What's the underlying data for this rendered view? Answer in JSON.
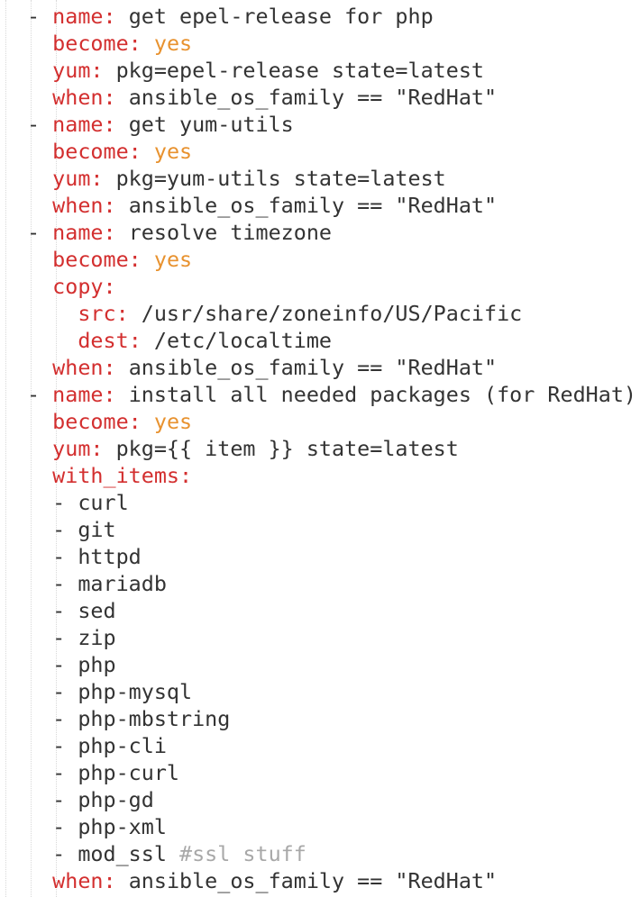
{
  "lines": [
    [
      [
        "dash",
        "- "
      ],
      [
        "key",
        "name"
      ],
      [
        "colon",
        ":"
      ],
      [
        "text",
        " get epel-release for php"
      ]
    ],
    [
      [
        "text",
        "  "
      ],
      [
        "key",
        "become"
      ],
      [
        "colon",
        ":"
      ],
      [
        "text",
        " "
      ],
      [
        "bool",
        "yes"
      ]
    ],
    [
      [
        "text",
        "  "
      ],
      [
        "key",
        "yum"
      ],
      [
        "colon",
        ":"
      ],
      [
        "text",
        " pkg=epel-release state=latest"
      ]
    ],
    [
      [
        "text",
        "  "
      ],
      [
        "key",
        "when"
      ],
      [
        "colon",
        ":"
      ],
      [
        "text",
        " ansible_os_family == \"RedHat\""
      ]
    ],
    [
      [
        "dash",
        "- "
      ],
      [
        "key",
        "name"
      ],
      [
        "colon",
        ":"
      ],
      [
        "text",
        " get yum-utils"
      ]
    ],
    [
      [
        "text",
        "  "
      ],
      [
        "key",
        "become"
      ],
      [
        "colon",
        ":"
      ],
      [
        "text",
        " "
      ],
      [
        "bool",
        "yes"
      ]
    ],
    [
      [
        "text",
        "  "
      ],
      [
        "key",
        "yum"
      ],
      [
        "colon",
        ":"
      ],
      [
        "text",
        " pkg=yum-utils state=latest"
      ]
    ],
    [
      [
        "text",
        "  "
      ],
      [
        "key",
        "when"
      ],
      [
        "colon",
        ":"
      ],
      [
        "text",
        " ansible_os_family == \"RedHat\""
      ]
    ],
    [
      [
        "dash",
        "- "
      ],
      [
        "key",
        "name"
      ],
      [
        "colon",
        ":"
      ],
      [
        "text",
        " resolve timezone"
      ]
    ],
    [
      [
        "text",
        "  "
      ],
      [
        "key",
        "become"
      ],
      [
        "colon",
        ":"
      ],
      [
        "text",
        " "
      ],
      [
        "bool",
        "yes"
      ]
    ],
    [
      [
        "text",
        "  "
      ],
      [
        "key",
        "copy"
      ],
      [
        "colon",
        ":"
      ]
    ],
    [
      [
        "text",
        "    "
      ],
      [
        "key",
        "src"
      ],
      [
        "colon",
        ":"
      ],
      [
        "text",
        " /usr/share/zoneinfo/US/Pacific"
      ]
    ],
    [
      [
        "text",
        "    "
      ],
      [
        "key",
        "dest"
      ],
      [
        "colon",
        ":"
      ],
      [
        "text",
        " /etc/localtime"
      ]
    ],
    [
      [
        "text",
        "  "
      ],
      [
        "key",
        "when"
      ],
      [
        "colon",
        ":"
      ],
      [
        "text",
        " ansible_os_family == \"RedHat\""
      ]
    ],
    [
      [
        "dash",
        "- "
      ],
      [
        "key",
        "name"
      ],
      [
        "colon",
        ":"
      ],
      [
        "text",
        " install all needed packages (for RedHat)"
      ]
    ],
    [
      [
        "text",
        "  "
      ],
      [
        "key",
        "become"
      ],
      [
        "colon",
        ":"
      ],
      [
        "text",
        " "
      ],
      [
        "bool",
        "yes"
      ]
    ],
    [
      [
        "text",
        "  "
      ],
      [
        "key",
        "yum"
      ],
      [
        "colon",
        ":"
      ],
      [
        "text",
        " pkg={{ item }} state=latest"
      ]
    ],
    [
      [
        "text",
        "  "
      ],
      [
        "key",
        "with_items"
      ],
      [
        "colon",
        ":"
      ]
    ],
    [
      [
        "text",
        "  - curl"
      ]
    ],
    [
      [
        "text",
        "  - git"
      ]
    ],
    [
      [
        "text",
        "  - httpd"
      ]
    ],
    [
      [
        "text",
        "  - mariadb"
      ]
    ],
    [
      [
        "text",
        "  - sed"
      ]
    ],
    [
      [
        "text",
        "  - zip"
      ]
    ],
    [
      [
        "text",
        "  - php"
      ]
    ],
    [
      [
        "text",
        "  - php-mysql"
      ]
    ],
    [
      [
        "text",
        "  - php-mbstring"
      ]
    ],
    [
      [
        "text",
        "  - php-cli"
      ]
    ],
    [
      [
        "text",
        "  - php-curl"
      ]
    ],
    [
      [
        "text",
        "  - php-gd"
      ]
    ],
    [
      [
        "text",
        "  - php-xml"
      ]
    ],
    [
      [
        "text",
        "  - mod_ssl "
      ],
      [
        "comment",
        "#ssl stuff"
      ]
    ],
    [
      [
        "text",
        "  "
      ],
      [
        "key",
        "when"
      ],
      [
        "colon",
        ":"
      ],
      [
        "text",
        " ansible_os_family == \"RedHat\""
      ]
    ]
  ],
  "colors": {
    "key": "#d32f2f",
    "bool": "#e8922f",
    "comment": "#a8a8a8",
    "text": "#333333",
    "indent_guide": "#d8d8d8"
  }
}
